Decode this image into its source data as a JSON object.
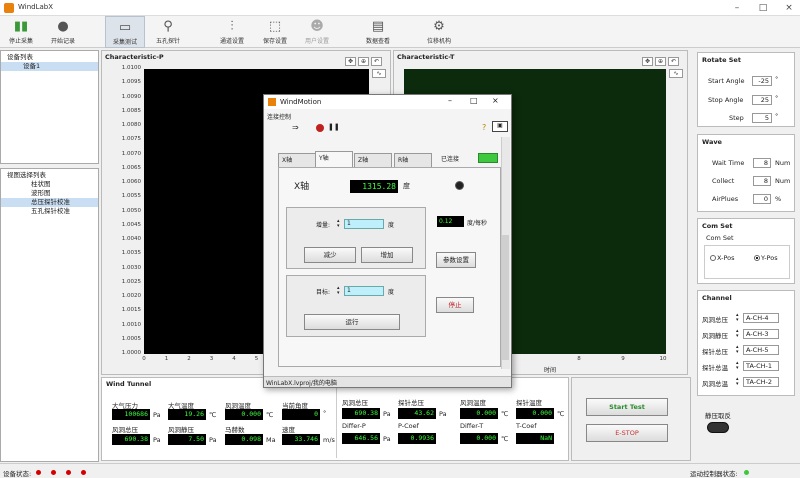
{
  "app": {
    "title": "WindLabX"
  },
  "toolbar": {
    "items": [
      {
        "label": "停止采集",
        "icon": "bar-chart-icon"
      },
      {
        "label": "开始记录",
        "icon": "record-circle-icon"
      },
      {
        "label": "采集测试",
        "icon": "monitor-icon"
      },
      {
        "label": "五孔探针",
        "icon": "probe-icon"
      },
      {
        "label": "通道设置",
        "icon": "sliders-icon"
      },
      {
        "label": "保存设置",
        "icon": "save-icon"
      },
      {
        "label": "用户设置",
        "icon": "user-icon"
      },
      {
        "label": "数据查看",
        "icon": "window-icon"
      },
      {
        "label": "位移机构",
        "icon": "gear-icon"
      }
    ]
  },
  "left": {
    "device_list_title": "设备列表",
    "device_item": "设备1",
    "view_list_title": "视图选择列表",
    "view_items": [
      "柱状图",
      "波形图",
      "总压探针校准",
      "五孔探针校准"
    ],
    "selected_view": "总压探针校准"
  },
  "plot_p": {
    "label": "Characteristic-P",
    "y_ticks": [
      "1.0100",
      "1.0095",
      "1.0090",
      "1.0085",
      "1.0080",
      "1.0075",
      "1.0070",
      "1.0065",
      "1.0060",
      "1.0055",
      "1.0050",
      "1.0045",
      "1.0040",
      "1.0035",
      "1.0030",
      "1.0025",
      "1.0020",
      "1.0015",
      "1.0010",
      "1.0005",
      "1.0000"
    ],
    "x_ticks": [
      "0",
      "1",
      "2",
      "3",
      "4",
      "5",
      "6",
      "7",
      "8",
      "9",
      "10"
    ]
  },
  "plot_t": {
    "label": "Characteristic-T",
    "x_ticks": [
      "8",
      "9",
      "10"
    ],
    "xlabel": "时间"
  },
  "rotate_set": {
    "title": "Rotate Set",
    "start_angle_label": "Start Angle",
    "start_angle": "-25",
    "stop_angle_label": "Stop Angle",
    "stop_angle": "25",
    "step_label": "Step",
    "step": "5",
    "unit": "°"
  },
  "wave": {
    "title": "Wave",
    "wait_time_label": "Wait Time",
    "wait_time": "8",
    "wait_unit": "Num",
    "collect_label": "Collect",
    "collect": "8",
    "collect_unit": "Num",
    "airplues_label": "AirPlues",
    "airplues": "0",
    "airplues_unit": "%"
  },
  "com_set": {
    "title": "Com Set",
    "sub": "Com Set",
    "x_pos": "X-Pos",
    "y_pos": "Y-Pos",
    "selected": "Y-Pos"
  },
  "channel": {
    "title": "Channel",
    "rows": [
      {
        "label": "风洞总压",
        "value": "A-CH-4"
      },
      {
        "label": "风洞静压",
        "value": "A-CH-3"
      },
      {
        "label": "探针总压",
        "value": "A-CH-5"
      },
      {
        "label": "探针总温",
        "value": "TA-CH-1"
      },
      {
        "label": "风洞总温",
        "value": "TA-CH-2"
      }
    ]
  },
  "wind_tunnel": {
    "title": "Wind Tunnel",
    "atm_pressure_label": "大气压力",
    "atm_pressure": "100686",
    "atm_pressure_unit": "Pa",
    "atm_temp_label": "大气温度",
    "atm_temp": "19.26",
    "atm_temp_unit": "℃",
    "tunnel_temp_label": "风洞温度",
    "tunnel_temp": "0.000",
    "tunnel_temp_unit": "℃",
    "angle_label": "当前角度",
    "angle": "0",
    "angle_unit": "°",
    "tunnel_total_p_label": "风洞总压",
    "tunnel_total_p": "690.38",
    "tunnel_total_p_unit": "Pa",
    "tunnel_static_p_label": "风洞静压",
    "tunnel_static_p": "7.50",
    "tunnel_static_p_unit": "Pa",
    "mach_label": "马赫数",
    "mach": "0.098",
    "mach_unit": "Ma",
    "speed_label": "速度",
    "speed": "33.746",
    "speed_unit": "m/s"
  },
  "probe": {
    "r1": [
      {
        "label": "风洞总压",
        "value": "690.38",
        "unit": "Pa"
      },
      {
        "label": "探针总压",
        "value": "43.62",
        "unit": "Pa"
      },
      {
        "label": "风洞温度",
        "value": "0.000",
        "unit": "℃"
      },
      {
        "label": "探针温度",
        "value": "0.000",
        "unit": "℃"
      }
    ],
    "r2": [
      {
        "label": "Differ-P",
        "value": "646.56",
        "unit": "Pa"
      },
      {
        "label": "P-Coef",
        "value": "0.9936",
        "unit": ""
      },
      {
        "label": "Differ-T",
        "value": "0.000",
        "unit": "℃"
      },
      {
        "label": "T-Coef",
        "value": "NaN",
        "unit": ""
      }
    ]
  },
  "actions": {
    "start_test": "Start Test",
    "estop": "E-STOP",
    "mute_label": "静压取反"
  },
  "dialog": {
    "title": "WindMotion",
    "menu": "连接控制",
    "tabs": [
      "X轴",
      "Y轴",
      "Z轴",
      "R轴"
    ],
    "active_tab": "Y轴",
    "connected_label": "已连接",
    "axis_label": "X轴",
    "axis_value": "1315.28",
    "axis_unit": "度",
    "delta_label": "增量:",
    "delta_value": "1",
    "delta_unit": "度",
    "decrease": "减少",
    "increase": "增加",
    "speed_value": "0.12",
    "speed_unit": "度/每秒",
    "params_btn": "参数设置",
    "target_label": "目标:",
    "target_value": "1",
    "target_unit": "度",
    "stop_btn": "停止",
    "run_btn": "运行",
    "path": "WinLabX.lvproj/我的电脑"
  },
  "status": {
    "device_status": "设备状态:",
    "controller_status": "运动控制器状态:",
    "led_red": "#d40000",
    "led_green": "#3ec83e"
  },
  "colors": {
    "plot_bg": "#000000",
    "plot_t_bg": "#0c2a0c",
    "digit": "#3cff3c",
    "accent": "#2b6cb0"
  }
}
